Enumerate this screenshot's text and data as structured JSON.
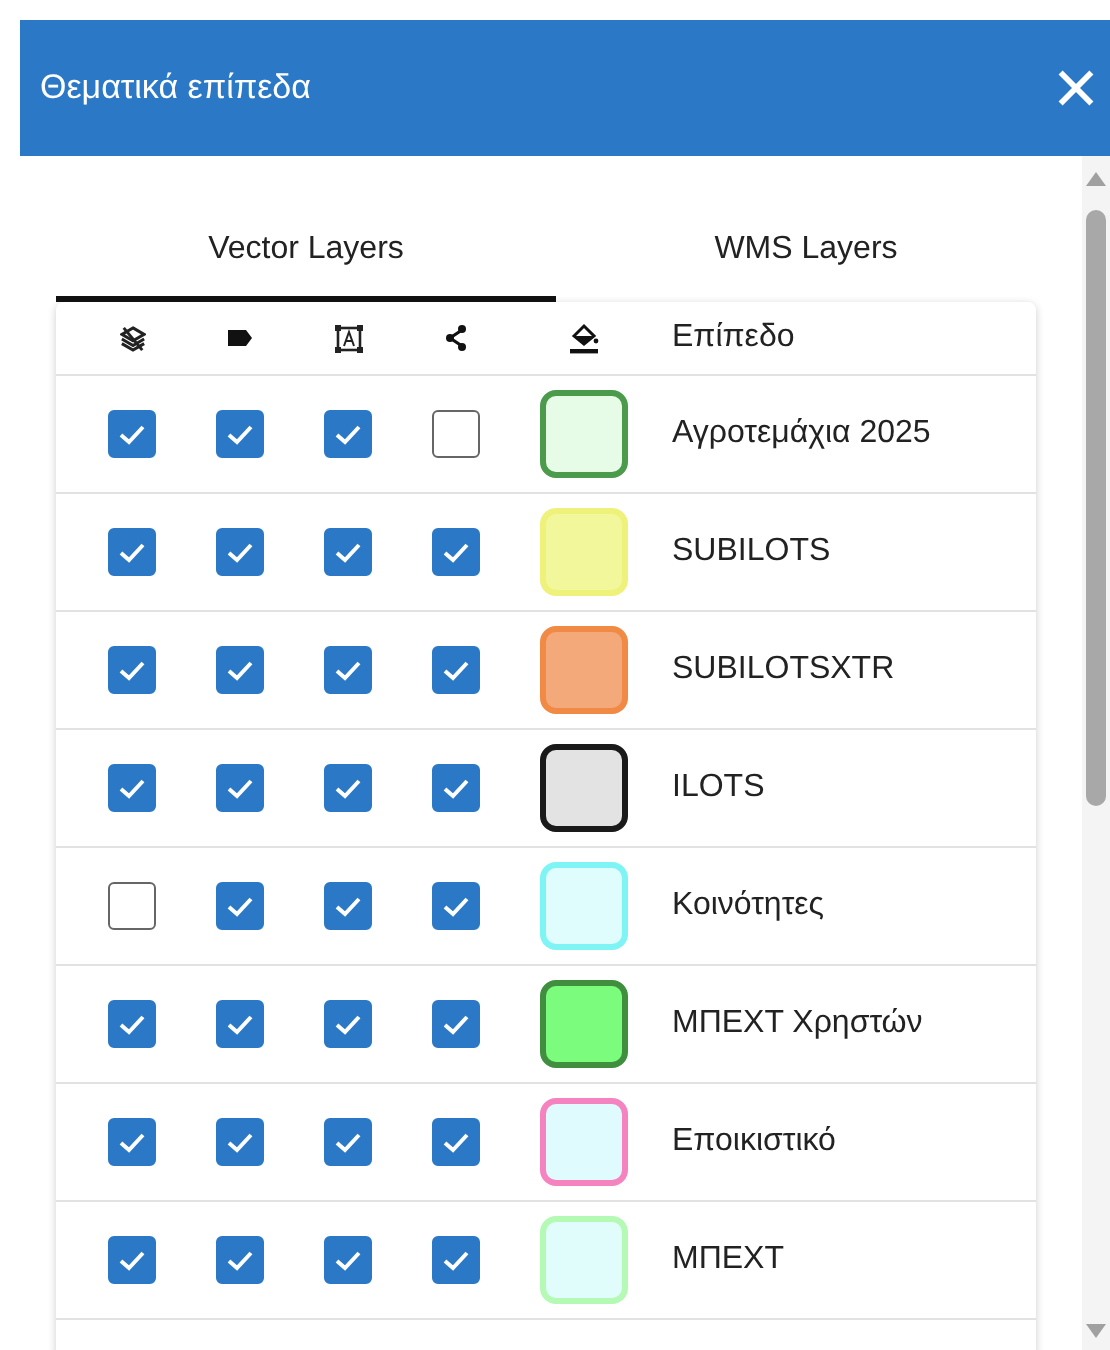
{
  "window": {
    "title": "Θεματικά επίπεδα"
  },
  "tabs": [
    {
      "label": "Vector Layers",
      "selected": true
    },
    {
      "label": "WMS Layers",
      "selected": false
    }
  ],
  "table": {
    "name_header": "Επίπεδο",
    "rows": [
      {
        "visible": true,
        "labels": true,
        "extent": true,
        "snap": false,
        "fill": {
          "color": "#e6fce6"
        },
        "border": {
          "color": "#4c9a4c"
        },
        "name": "Αγροτεμάχια 2025"
      },
      {
        "visible": true,
        "labels": true,
        "extent": true,
        "snap": true,
        "fill": {
          "color": "#f3f79c"
        },
        "border": {
          "color": "#eef27a"
        },
        "name": "SUBILOTS"
      },
      {
        "visible": true,
        "labels": true,
        "extent": true,
        "snap": true,
        "fill": {
          "color": "#f4a97a"
        },
        "border": {
          "color": "#f08a44"
        },
        "name": "SUBILOTSXTR"
      },
      {
        "visible": true,
        "labels": true,
        "extent": true,
        "snap": true,
        "fill": {
          "color": "#e3e3e3"
        },
        "border": {
          "color": "#1a1a1a"
        },
        "name": "ILOTS"
      },
      {
        "visible": false,
        "labels": true,
        "extent": true,
        "snap": true,
        "fill": {
          "color": "#e0fdfd"
        },
        "border": {
          "color": "#7ef4f4"
        },
        "name": "Κοινότητες"
      },
      {
        "visible": true,
        "labels": true,
        "extent": true,
        "snap": true,
        "fill": {
          "color": "#7cfc7c"
        },
        "border": {
          "color": "#3f8f3f"
        },
        "name": "ΜΠΕΧΤ Χρηστών"
      },
      {
        "visible": true,
        "labels": true,
        "extent": true,
        "snap": true,
        "fill": {
          "color": "#e0fbfd"
        },
        "border": {
          "color": "#f583c0"
        },
        "name": "Εποικιστικό"
      },
      {
        "visible": true,
        "labels": true,
        "extent": true,
        "snap": true,
        "fill": {
          "color": "#e0fdfb"
        },
        "border": {
          "color": "#b4f9b4"
        },
        "name": "ΜΠΕΧΤ"
      }
    ]
  }
}
